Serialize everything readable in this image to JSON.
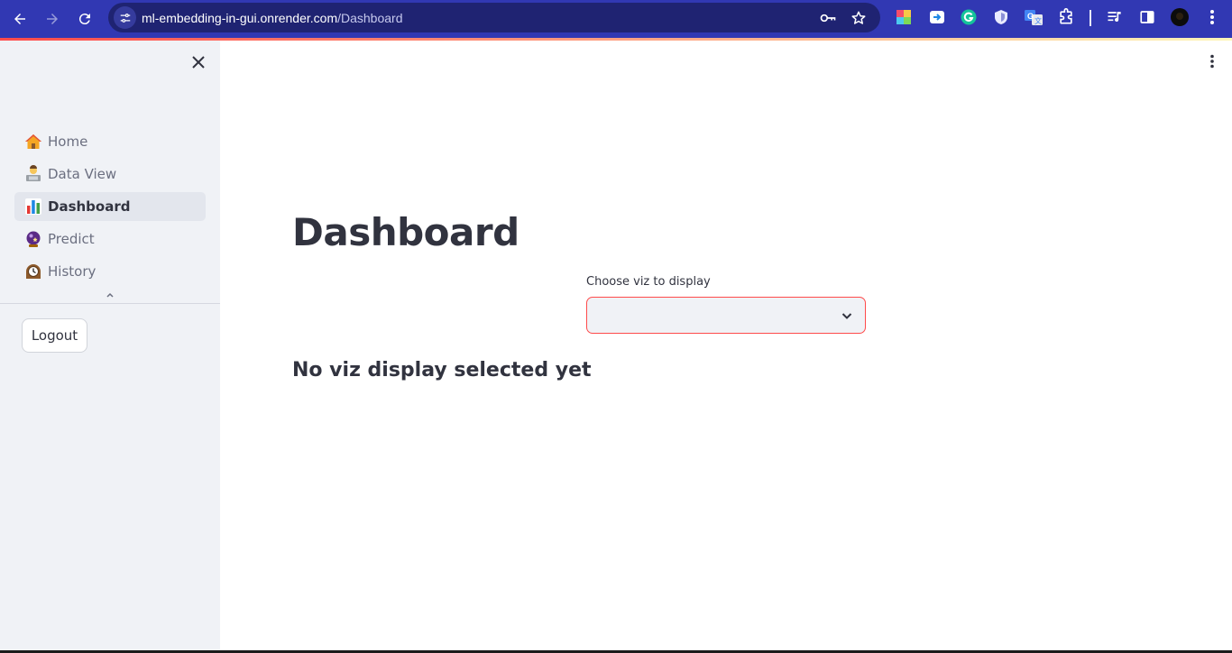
{
  "browser": {
    "url_host": "ml-embedding-in-gui.onrender.com",
    "url_path": "/Dashboard",
    "icons": [
      "back-icon",
      "forward-icon",
      "reload-icon",
      "site-info-icon",
      "key-icon",
      "star-icon",
      "extension-colorful-icon",
      "extension-screen-icon",
      "grammarly-icon",
      "shield-extension-icon",
      "translate-icon",
      "puzzle-icon",
      "media-icon",
      "side-panel-icon",
      "profile-avatar",
      "browser-menu-icon"
    ],
    "colors": {
      "toolbar": "#3138b3",
      "omnibox": "#1f2372"
    }
  },
  "sidebar": {
    "items": [
      {
        "label": "Home",
        "icon": "house-icon",
        "active": false
      },
      {
        "label": "Data View",
        "icon": "technologist-icon",
        "active": false
      },
      {
        "label": "Dashboard",
        "icon": "bar-chart-icon",
        "active": true
      },
      {
        "label": "Predict",
        "icon": "crystal-ball-icon",
        "active": false
      },
      {
        "label": "History",
        "icon": "mantelpiece-clock-icon",
        "active": false
      }
    ],
    "logout_label": "Logout"
  },
  "main": {
    "title": "Dashboard",
    "select": {
      "label": "Choose viz to display",
      "value": ""
    },
    "status": "No viz display selected yet"
  },
  "colors": {
    "accent": "#ff4b4b",
    "sidebar_bg": "#f0f2f6",
    "text": "#31333f"
  }
}
